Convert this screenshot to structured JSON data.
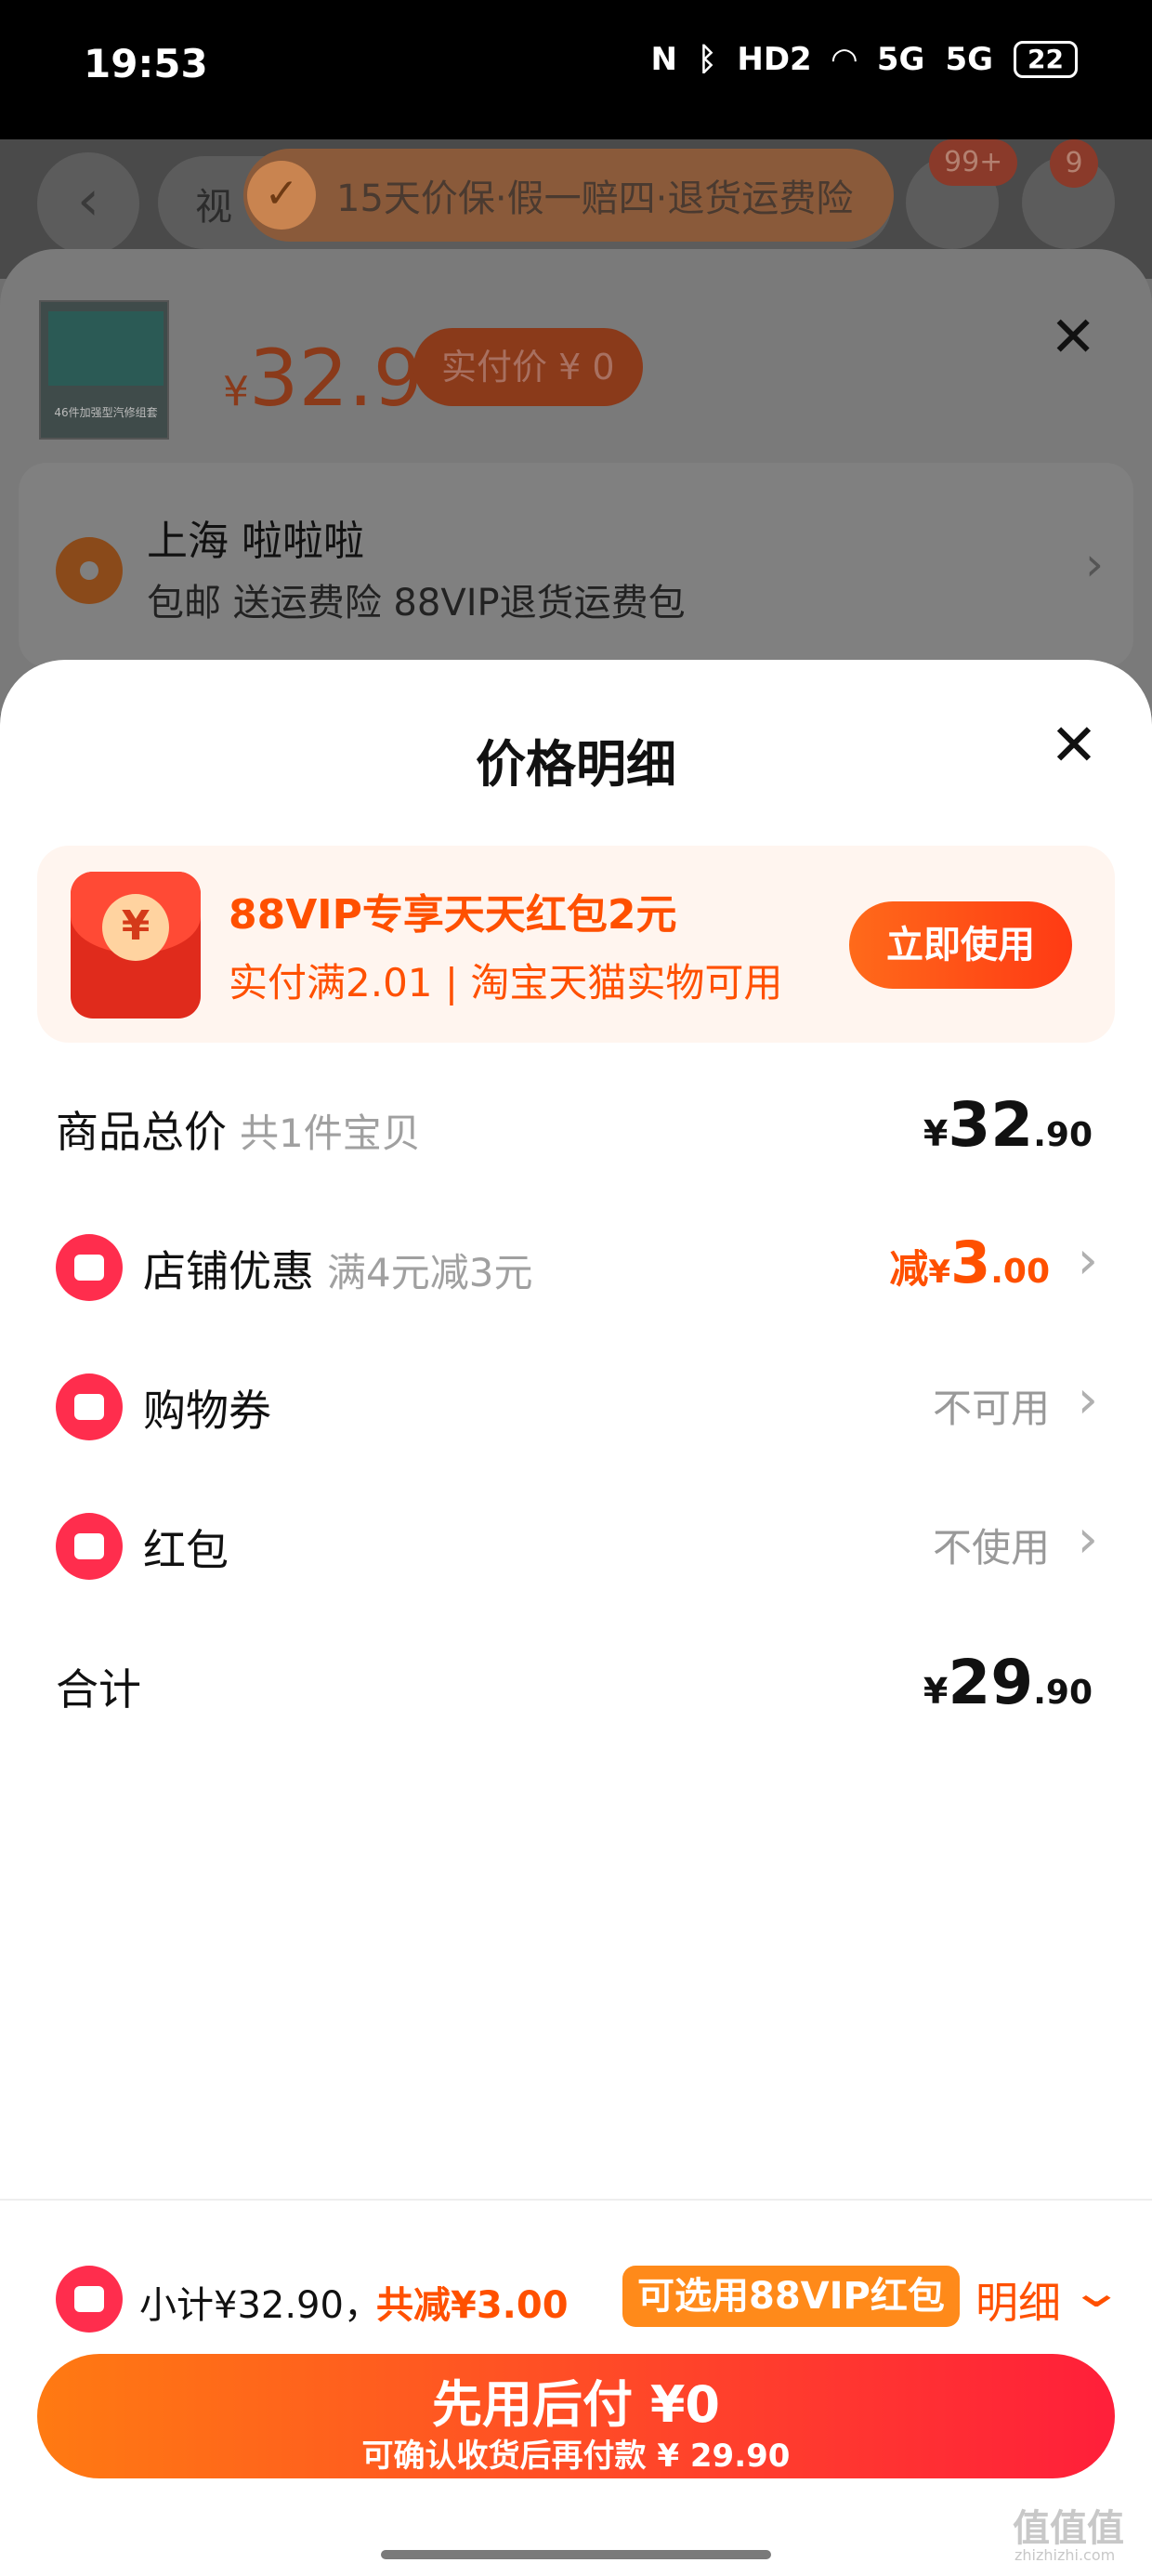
{
  "status_bar": {
    "time": "19:53",
    "icons": [
      "nfc-icon",
      "bluetooth-icon",
      "hd-icon",
      "wifi-icon",
      "5g-signal-icon",
      "5g-signal-icon"
    ],
    "hd_label": "HD2",
    "net1": "5G",
    "net2": "5G",
    "battery": "22"
  },
  "background_page": {
    "search_word": "视",
    "banner_text": "15天价保·假一赔四·退货运费险",
    "cart_badge": "99+",
    "more_badge": "9"
  },
  "sku_panel": {
    "thumbnail_caption": "46件加强型汽修组套",
    "price_currency": "¥",
    "price": "32.9",
    "actual_price_label": "实付价 ¥ 0",
    "address_name": "上海 啦啦啦",
    "address_desc": "包邮 送运费险 88VIP退货运费包"
  },
  "price_detail": {
    "title": "价格明细",
    "promo": {
      "coin": "¥",
      "title": "88VIP专享天天红包2元",
      "subtitle": "实付满2.01 | 淘宝天猫实物可用",
      "button": "立即使用"
    },
    "total_row": {
      "label": "商品总价",
      "sub": "共1件宝贝",
      "currency": "¥",
      "int": "32",
      "dec": ".90"
    },
    "shop_discount": {
      "label": "店铺优惠",
      "sub": "满4元减3元",
      "prefix": "减",
      "currency": "¥",
      "int": "3",
      "dec": ".00"
    },
    "coupon": {
      "label": "购物券",
      "value": "不可用"
    },
    "red_packet": {
      "label": "红包",
      "value": "不使用"
    },
    "sum_row": {
      "label": "合计",
      "currency": "¥",
      "int": "29",
      "dec": ".90"
    }
  },
  "bottom_bar": {
    "subtotal": "小计¥32.90，",
    "discount": "共减¥3.00",
    "badge": "可选用88VIP红包",
    "detail": "明细",
    "pay_main": "先用后付 ¥0",
    "pay_sub": "可确认收货后再付款 ¥ 29.90"
  },
  "watermark": {
    "main": "值值值",
    "sub": "zhizhizhi.com"
  },
  "colors": {
    "accent": "#ff5000",
    "pay_gradient_start": "#ff7a12",
    "pay_gradient_end": "#ff1f3a",
    "icon_red": "#ff2d4d"
  }
}
